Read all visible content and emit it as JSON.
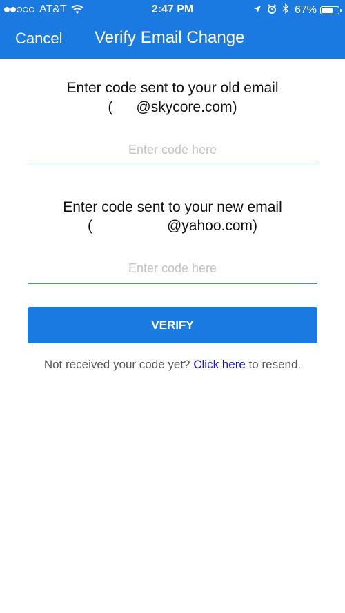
{
  "status_bar": {
    "carrier": "AT&T",
    "time": "2:47 PM",
    "battery_percent": "67%",
    "battery_level": 0.67,
    "signal_bars_filled": 2,
    "signal_bars_total": 5,
    "icons": [
      "wifi-icon",
      "location-arrow-icon",
      "alarm-icon",
      "bluetooth-icon",
      "battery-icon"
    ]
  },
  "nav": {
    "cancel_label": "Cancel",
    "title": "Verify Email Change"
  },
  "old_email": {
    "heading": "Enter code sent to your old email",
    "open_paren": "(",
    "email_suffix": "@skycore.com)",
    "input_placeholder": "Enter code here",
    "input_value": ""
  },
  "new_email": {
    "heading": "Enter code sent to your new email",
    "open_paren": "(",
    "email_suffix": "@yahoo.com)",
    "input_placeholder": "Enter code here",
    "input_value": ""
  },
  "verify_button_label": "VERIFY",
  "resend": {
    "prefix": "Not received your code yet? ",
    "link": "Click here",
    "suffix": " to resend."
  },
  "colors": {
    "primary": "#1a7ae0",
    "link": "#1212cc",
    "placeholder": "#c4c4c4",
    "text": "#111111"
  }
}
